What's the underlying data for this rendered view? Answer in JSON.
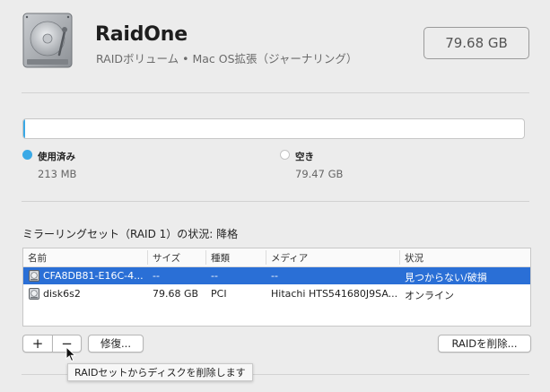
{
  "volume": {
    "name": "RaidOne",
    "subtitle": "RAIDボリューム • Mac OS拡張（ジャーナリング）",
    "size": "79.68 GB"
  },
  "usage": {
    "used_fraction": 0.0027,
    "used": {
      "label": "使用済み",
      "value": "213 MB",
      "color": "#3aa9e6"
    },
    "free": {
      "label": "空き",
      "value": "79.47 GB",
      "color": "#ffffff"
    }
  },
  "mirror": {
    "status_text": "ミラーリングセット（RAID 1）の状況: 降格",
    "columns": [
      "名前",
      "サイズ",
      "種類",
      "メディア",
      "状況"
    ],
    "rows": [
      {
        "name": "CFA8DB81-E16C-4...",
        "size": "--",
        "type": "--",
        "media": "--",
        "status": "見つからない/破損",
        "selected": true
      },
      {
        "name": "disk6s2",
        "size": "79.68 GB",
        "type": "PCI",
        "media": "Hitachi HTS541680J9SA...",
        "status": "オンライン",
        "selected": false
      }
    ]
  },
  "buttons": {
    "add": "+",
    "remove": "−",
    "repair": "修復...",
    "delete_raid": "RAIDを削除..."
  },
  "tooltip": "RAIDセットからディスクを削除します",
  "colors": {
    "selection": "#2a6fd6",
    "accent": "#3aa9e6"
  },
  "icons": {
    "volume": "hard-drive-icon",
    "row": "disk-icon",
    "pointer": "cursor-arrow-icon"
  }
}
